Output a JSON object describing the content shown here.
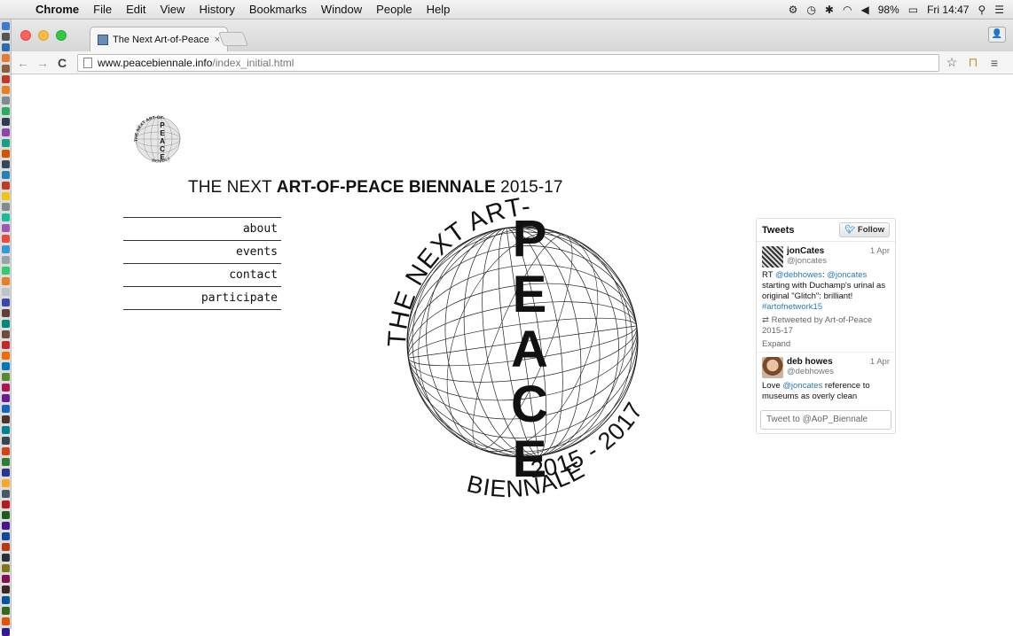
{
  "menubar": {
    "app_name": "Chrome",
    "items": [
      "File",
      "Edit",
      "View",
      "History",
      "Bookmarks",
      "Window",
      "People",
      "Help"
    ],
    "battery": "98%",
    "clock": "Fri 14:47"
  },
  "browser": {
    "tab_title": "The Next Art-of-Peace Bie",
    "tab_close": "×",
    "url_host": "www.peacebiennale.info",
    "url_path": "/index_initial.html"
  },
  "site": {
    "title_prefix": "THE NEXT ",
    "title_bold": "ART-OF-PEACE BIENNALE",
    "title_suffix": " 2015-17",
    "nav": [
      {
        "label": "about"
      },
      {
        "label": "events"
      },
      {
        "label": "contact"
      },
      {
        "label": "participate"
      }
    ]
  },
  "emblem": {
    "arc_text": "THE NEXT ART-OF-",
    "vertical_letters": [
      "P",
      "E",
      "A",
      "C",
      "E"
    ],
    "arc_years": "2015 - 2017",
    "arc_bottom": "BIENNALE"
  },
  "twitter": {
    "heading": "Tweets",
    "follow_label": "Follow",
    "tweets": [
      {
        "name": "jonCates",
        "handle": "@joncates",
        "date": "1 Apr",
        "text_prefix": "RT ",
        "mention1": "@debhowes",
        "sep": ": ",
        "mention2": "@joncates",
        "text_body": " starting with Duchamp's urinal as original \"Glitch\": brilliant! ",
        "hashtag": "#artofnetwork15",
        "retweeted": "Retweeted by Art-of-Peace 2015-17",
        "expand": "Expand"
      },
      {
        "name": "deb howes",
        "handle": "@debhowes",
        "date": "1 Apr",
        "text_prefix": "Love ",
        "mention1": "@joncates",
        "text_body": " reference to museums as overly clean"
      }
    ],
    "compose_placeholder": "Tweet to @AoP_Biennale"
  }
}
